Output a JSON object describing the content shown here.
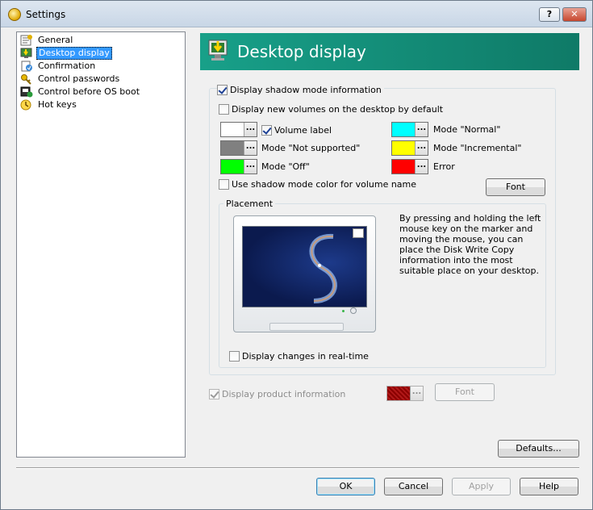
{
  "window": {
    "title": "Settings",
    "help_label": "?",
    "close_label": "✕"
  },
  "tree": {
    "items": [
      {
        "label": "General",
        "icon": "settings-icon"
      },
      {
        "label": "Desktop display",
        "icon": "desktop-icon",
        "selected": true
      },
      {
        "label": "Confirmation",
        "icon": "confirmation-icon"
      },
      {
        "label": "Control passwords",
        "icon": "key-icon"
      },
      {
        "label": "Control before OS boot",
        "icon": "boot-icon"
      },
      {
        "label": "Hot keys",
        "icon": "hotkeys-icon"
      }
    ]
  },
  "banner": {
    "title": "Desktop display",
    "icon": "desktop-display-icon"
  },
  "shadow": {
    "display_info_label": "Display shadow mode information",
    "display_info_checked": true,
    "new_volumes_label": "Display new volumes on the desktop by default",
    "new_volumes_checked": false,
    "volume_label": "Volume label",
    "volume_label_checked": true,
    "colors": [
      {
        "label": "Mode \"Normal\"",
        "color": "#00ffff"
      },
      {
        "label": "Mode \"Not supported\"",
        "color": "#808080"
      },
      {
        "label": "Mode \"Incremental\"",
        "color": "#ffff00"
      },
      {
        "label": "Mode \"Off\"",
        "color": "#00ff00"
      },
      {
        "label": "Error",
        "color": "#ff0000"
      }
    ],
    "volume_label_color": "#ffffff",
    "dots": "...",
    "use_shadow_color_label": "Use shadow mode color for volume name",
    "use_shadow_color_checked": false,
    "font_label": "Font"
  },
  "placement": {
    "label": "Placement",
    "description": "By pressing and holding the left mouse key on the marker and moving the mouse, you can place the Disk Write Copy information into the most suitable place on your desktop.",
    "realtime_label": "Display changes in real-time",
    "realtime_checked": false
  },
  "product": {
    "label": "Display product information",
    "checked": true,
    "disabled": true,
    "color": "#8b0000",
    "font_label": "Font"
  },
  "buttons": {
    "defaults": "Defaults...",
    "ok": "OK",
    "cancel": "Cancel",
    "apply": "Apply",
    "help": "Help"
  }
}
